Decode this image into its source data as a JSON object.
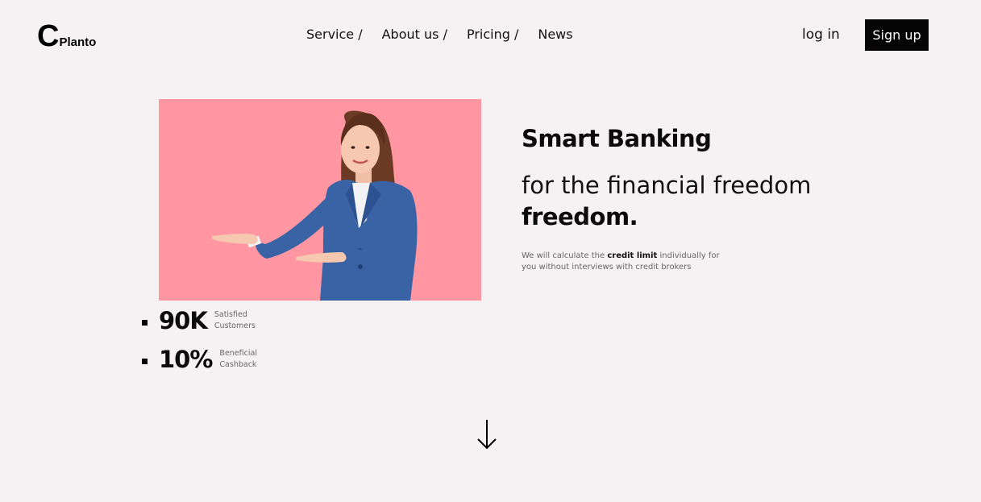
{
  "header": {
    "logo_mark": "C",
    "logo_text": "Planto",
    "nav": [
      "Service /",
      "About us /",
      "Pricing /",
      "News"
    ],
    "login_label": "log in",
    "signup_label": "Sign up"
  },
  "hero": {
    "title": "Smart Banking",
    "subtitle": "for the financial freedom",
    "subtitle_bold": "freedom.",
    "desc_prefix": "We will calculate the ",
    "desc_bold": "credit limit",
    "desc_suffix": " individually for you without interviews with credit brokers",
    "image_bg": "#ff96a2"
  },
  "stats": [
    {
      "value": "90K",
      "label": "Satisfied Customers"
    },
    {
      "value": "10%",
      "label": "Beneficial Cashback"
    }
  ],
  "scroll_icon": "arrow-down-icon"
}
